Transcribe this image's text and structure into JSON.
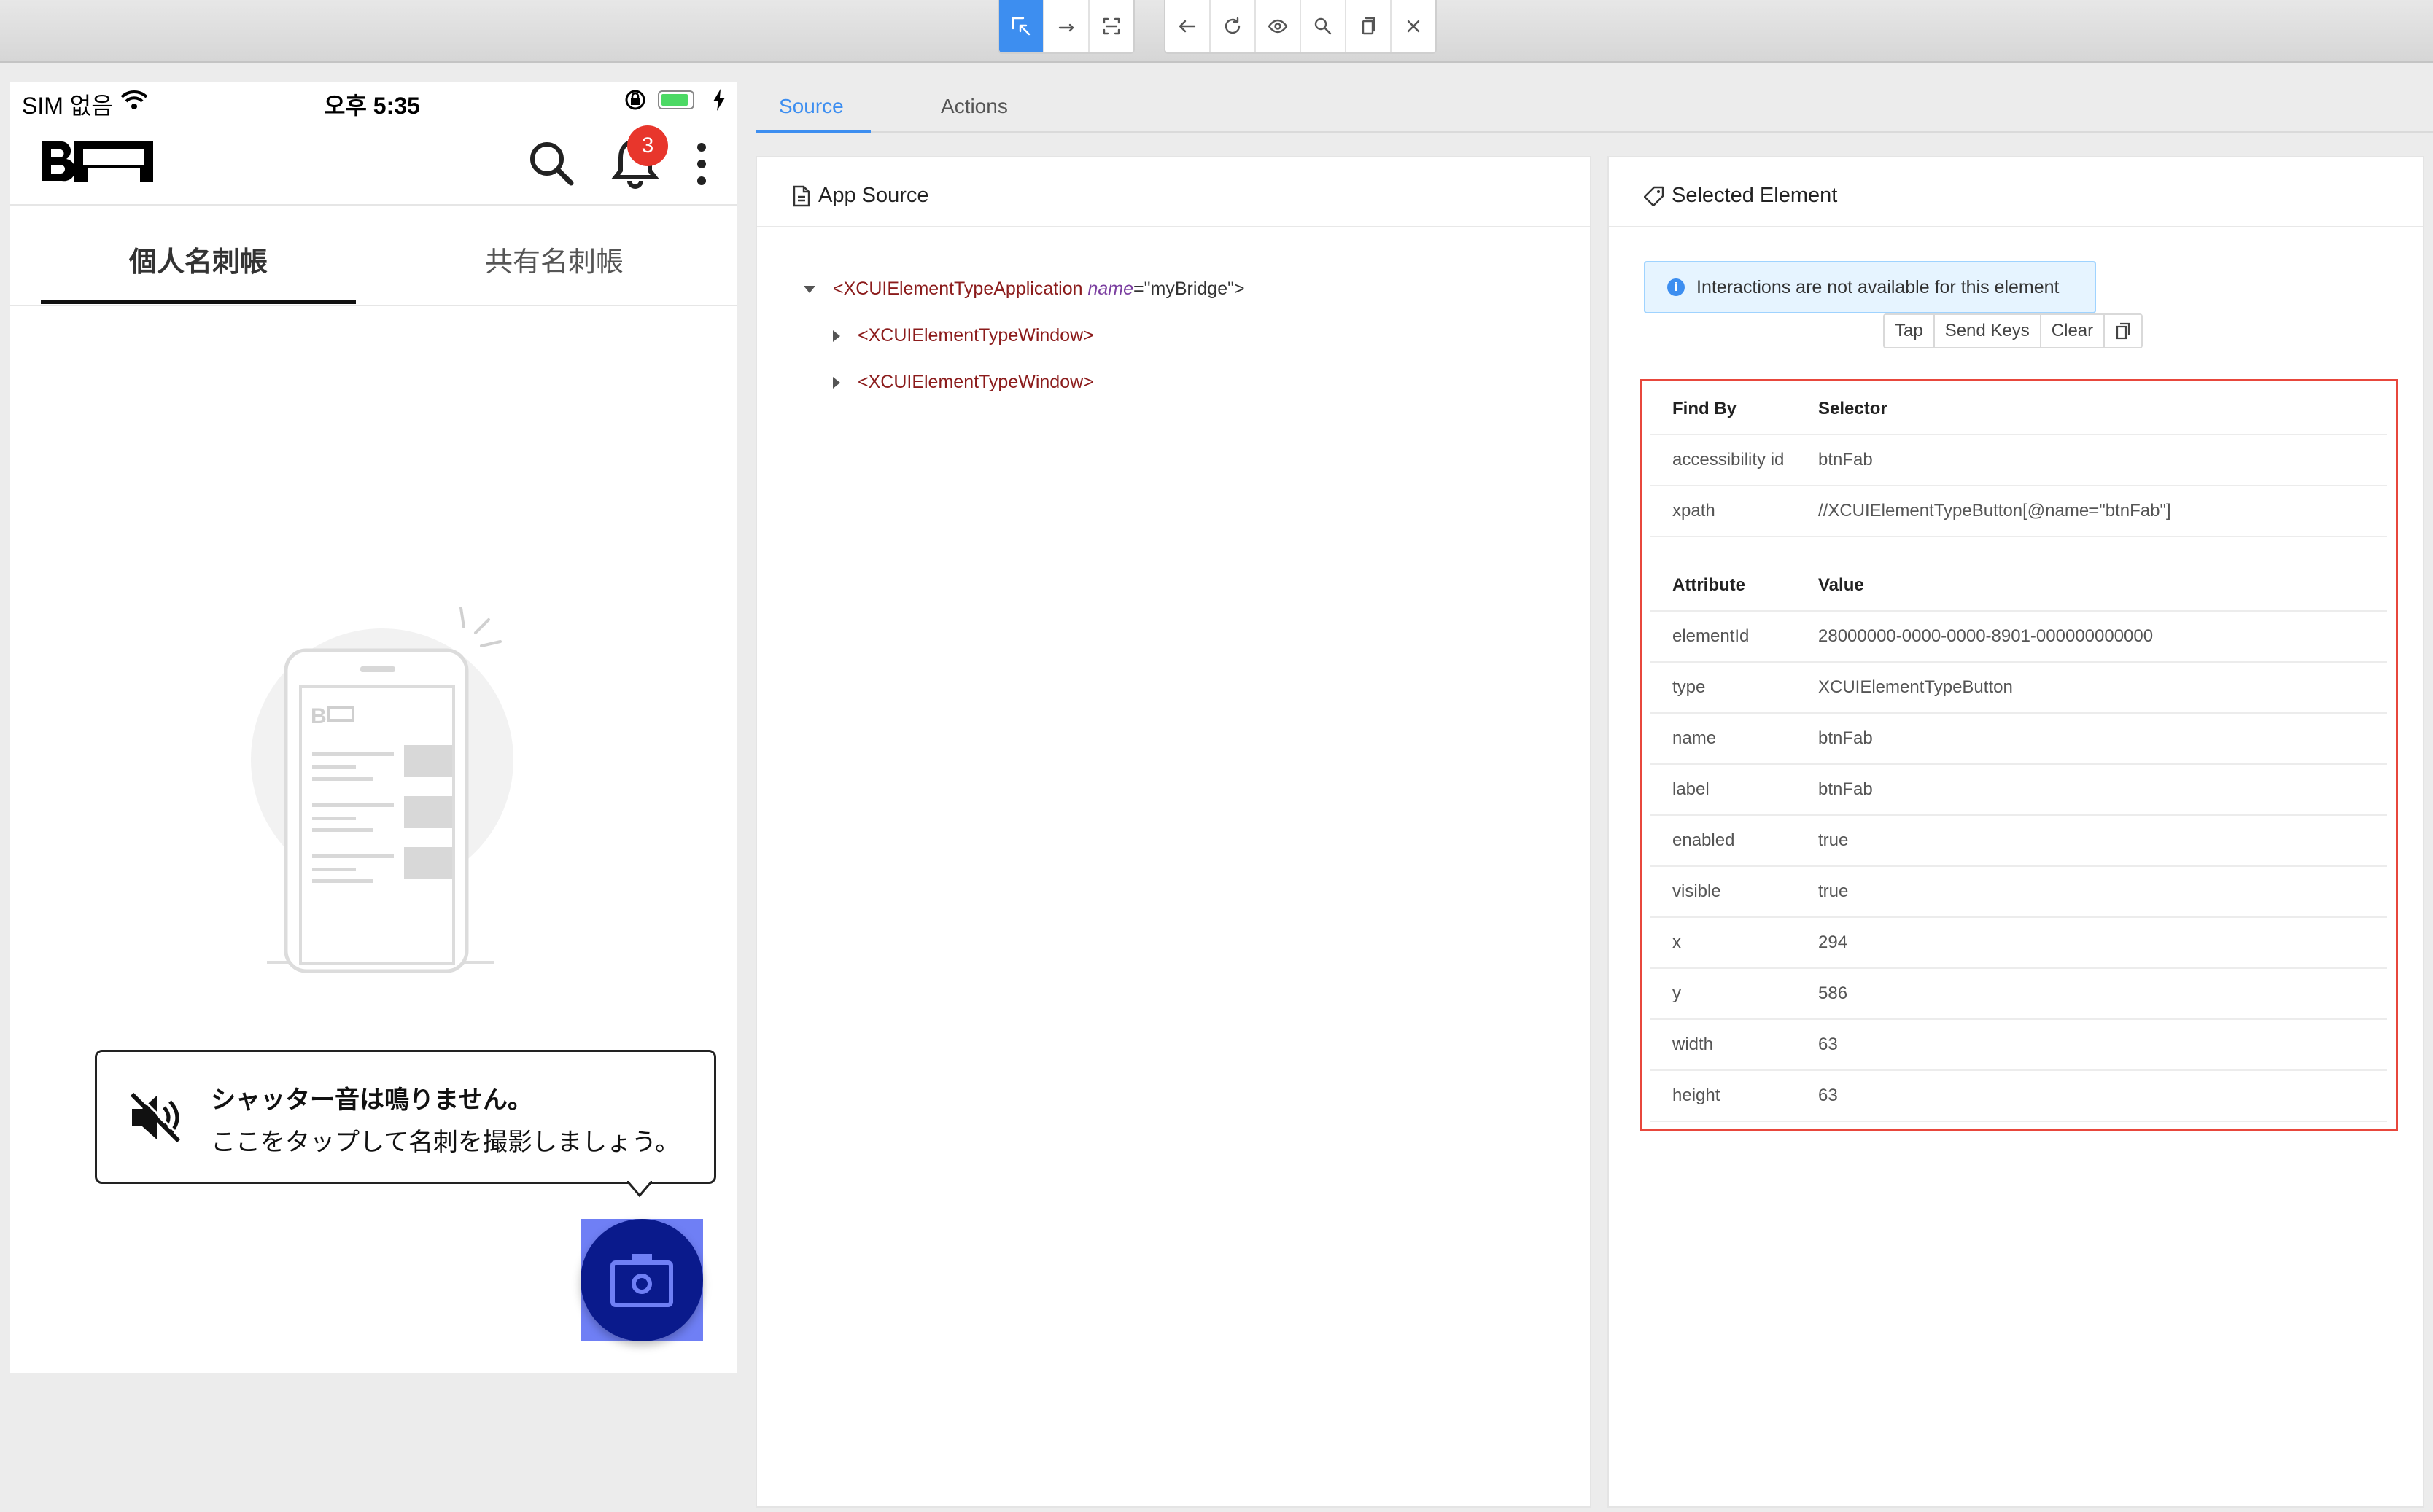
{
  "toolbar": {
    "group1": [
      "select-icon",
      "swipe-icon",
      "tap-coordinates-icon"
    ],
    "group2": [
      "back-icon",
      "refresh-icon",
      "eye-icon",
      "search-icon",
      "copy-icon",
      "close-icon"
    ]
  },
  "phone": {
    "status": {
      "carrier": "SIM 없음",
      "time": "오후 5:35"
    },
    "notification_count": "3",
    "tabs": [
      {
        "label": "個人名刺帳",
        "active": true
      },
      {
        "label": "共有名刺帳",
        "active": false
      }
    ],
    "tooltip": {
      "title": "シャッター音は鳴りません。",
      "body": "ここをタップして名刺を撮影しましょう。"
    },
    "accent_color": "#0a1a8c",
    "highlight_color": "#6f7ff5"
  },
  "inspector": {
    "tabs": [
      {
        "label": "Source",
        "active": true
      },
      {
        "label": "Actions",
        "active": false
      }
    ],
    "source_panel": {
      "title": "App Source",
      "tree": {
        "root_tag": "<XCUIElementTypeApplication",
        "root_attr": "name",
        "root_value": "=\"myBridge\">",
        "children": [
          "<XCUIElementTypeWindow>",
          "<XCUIElementTypeWindow>"
        ]
      }
    },
    "selected_panel": {
      "title": "Selected Element",
      "notice": "Interactions are not available for this element",
      "actions": [
        "Tap",
        "Send Keys",
        "Clear"
      ],
      "selectors_header": [
        "Find By",
        "Selector"
      ],
      "selectors": [
        {
          "by": "accessibility id",
          "value": "btnFab"
        },
        {
          "by": "xpath",
          "value": "//XCUIElementTypeButton[@name=\"btnFab\"]"
        }
      ],
      "attributes_header": [
        "Attribute",
        "Value"
      ],
      "attributes": [
        {
          "name": "elementId",
          "value": "28000000-0000-0000-8901-000000000000"
        },
        {
          "name": "type",
          "value": "XCUIElementTypeButton"
        },
        {
          "name": "name",
          "value": "btnFab"
        },
        {
          "name": "label",
          "value": "btnFab"
        },
        {
          "name": "enabled",
          "value": "true"
        },
        {
          "name": "visible",
          "value": "true"
        },
        {
          "name": "x",
          "value": "294"
        },
        {
          "name": "y",
          "value": "586"
        },
        {
          "name": "width",
          "value": "63"
        },
        {
          "name": "height",
          "value": "63"
        }
      ]
    }
  }
}
